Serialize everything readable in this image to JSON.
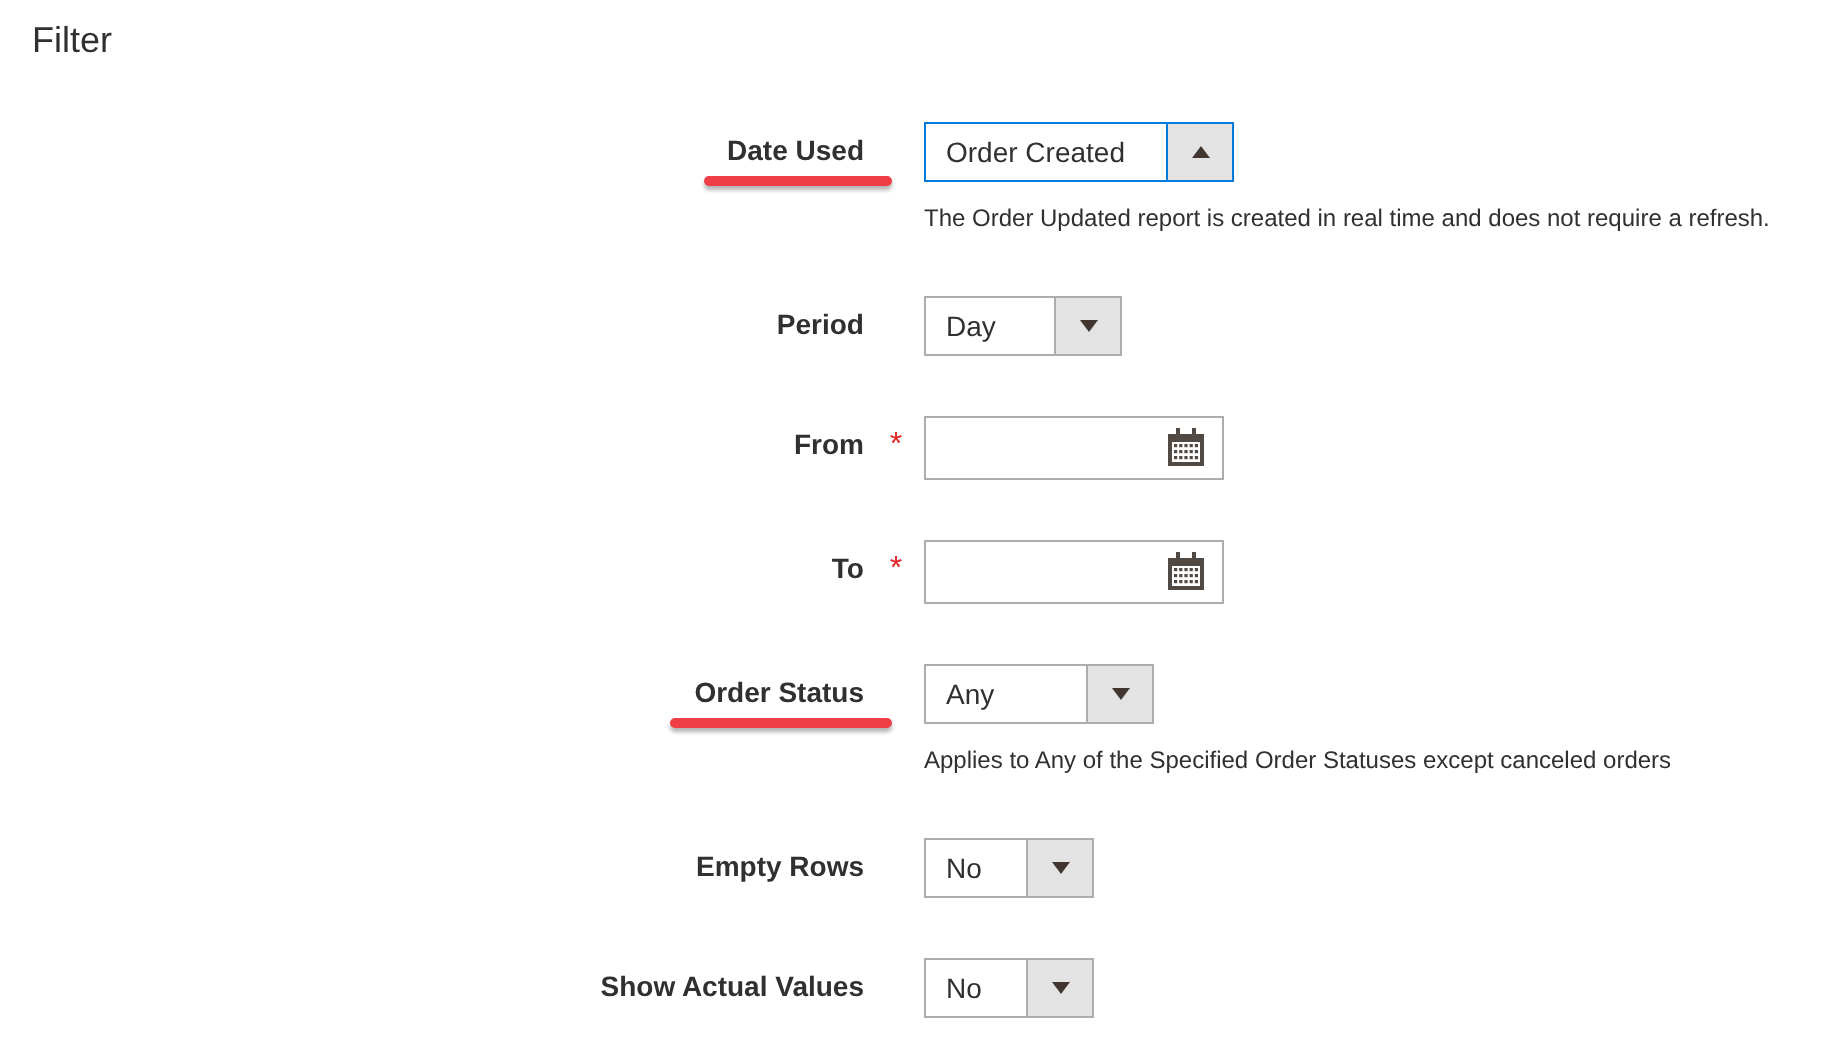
{
  "title": "Filter",
  "fields": [
    {
      "kind": "select",
      "label": "Date Used",
      "value": "Order Created",
      "expanded": true,
      "underlined": true,
      "note": "The Order Updated report is created in real time and does not require a refresh."
    },
    {
      "kind": "select",
      "label": "Period",
      "value": "Day",
      "expanded": false,
      "underlined": false
    },
    {
      "kind": "date",
      "label": "From",
      "underlined": false,
      "required_mark": "*"
    },
    {
      "kind": "date",
      "label": "To",
      "underlined": false,
      "required_mark": "*"
    },
    {
      "kind": "select",
      "label": "Order Status",
      "value": "Any",
      "expanded": false,
      "underlined": true,
      "note": "Applies to Any of the Specified Order Statuses except canceled orders"
    },
    {
      "kind": "select",
      "label": "Empty Rows",
      "value": "No",
      "expanded": false,
      "underlined": false
    },
    {
      "kind": "select",
      "label": "Show Actual Values",
      "value": "No",
      "expanded": false,
      "underlined": false
    }
  ]
}
